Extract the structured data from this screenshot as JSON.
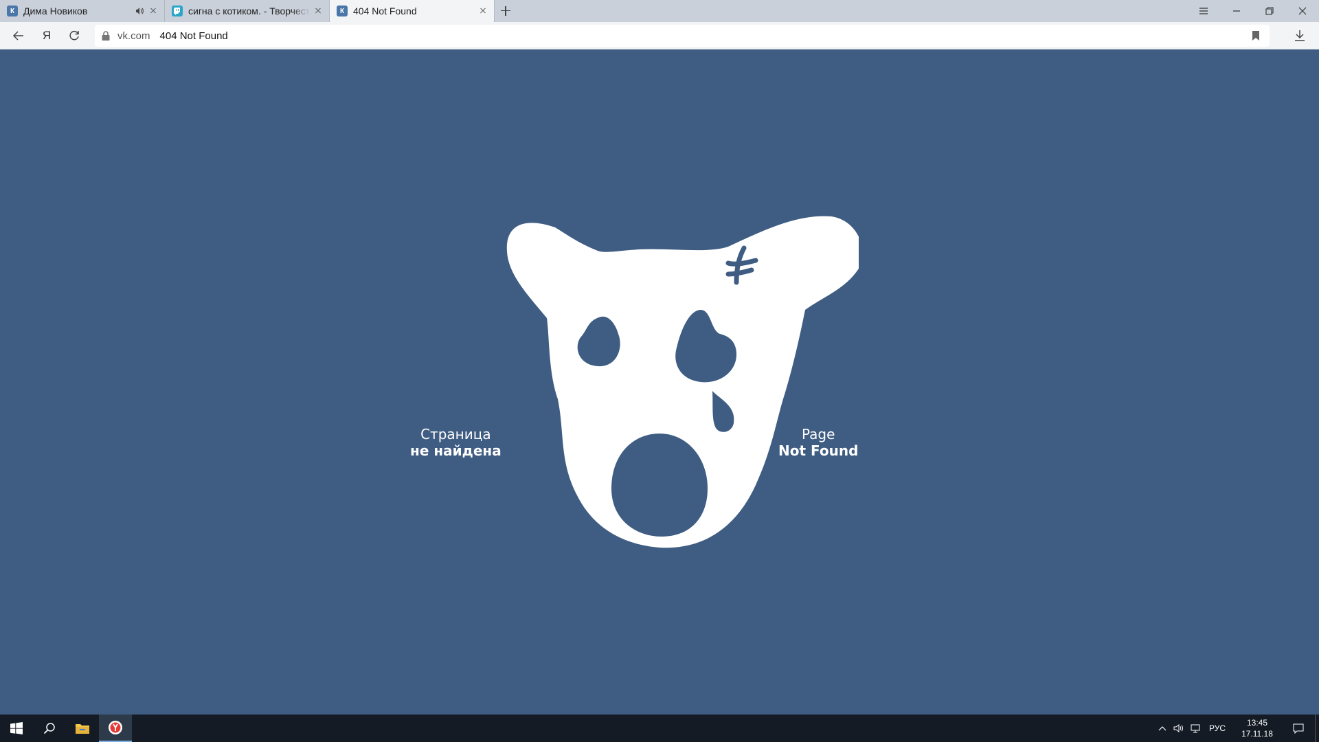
{
  "browser": {
    "tabs": [
      {
        "title": "Дима Новиков",
        "favicon": "vk-icon",
        "audio": true,
        "active": false
      },
      {
        "title": "сигна с котиком. - Творчество",
        "favicon": "twitch-icon",
        "audio": false,
        "active": false
      },
      {
        "title": "404 Not Found",
        "favicon": "vk-icon",
        "active": true
      }
    ],
    "address": {
      "domain": "vk.com",
      "title": "404 Not Found"
    },
    "yandex_glyph": "Я",
    "favicon_letter": "К"
  },
  "page": {
    "background": "#3f5d83",
    "caption_ru": {
      "line1": "Страница",
      "line2": "не найдена"
    },
    "caption_en": {
      "line1": "Page",
      "line2": "Not Found"
    }
  },
  "taskbar": {
    "language": "РУС",
    "time": "13:45",
    "date": "17.11.18",
    "pinned": [
      "windows-start-icon",
      "search-icon",
      "file-explorer-icon",
      "yandex-browser-icon"
    ]
  }
}
